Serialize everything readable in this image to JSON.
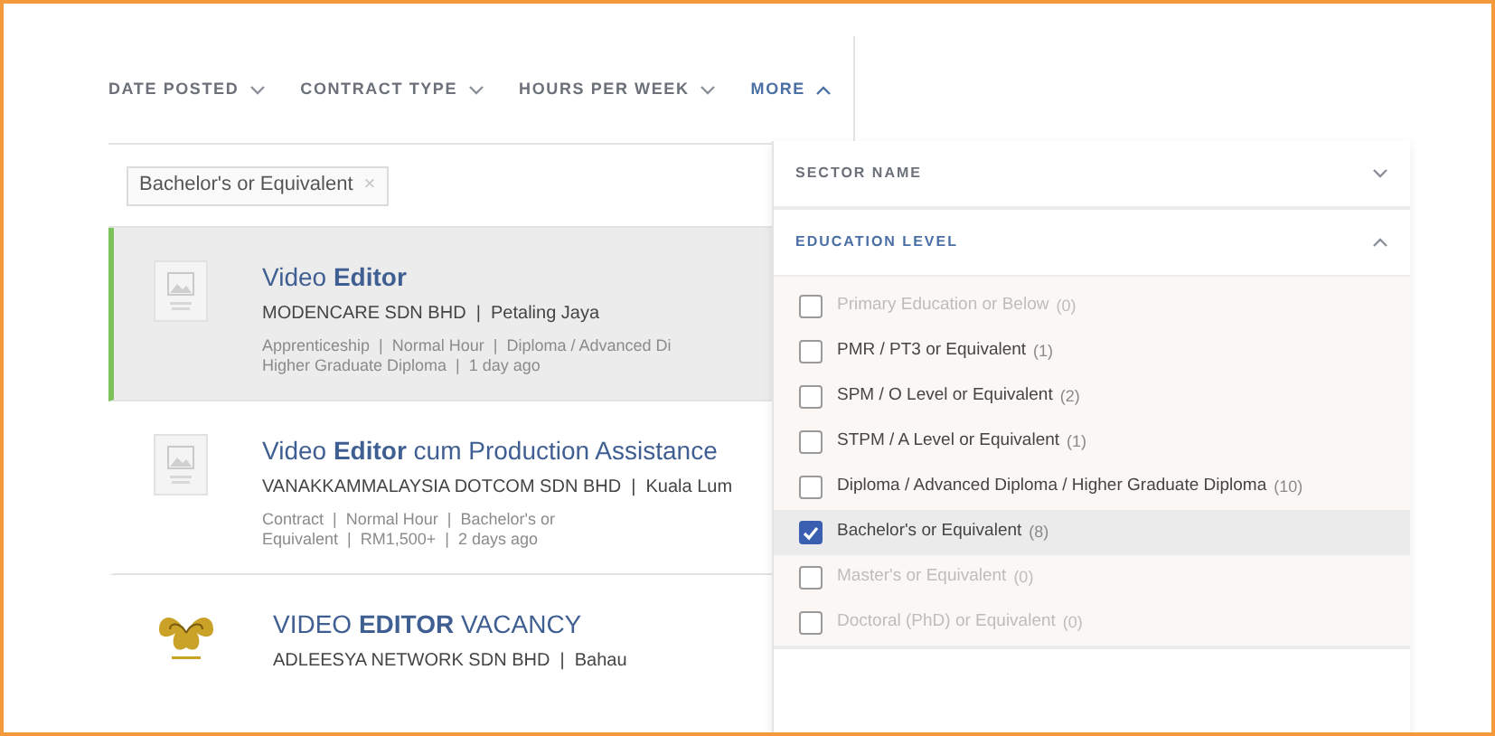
{
  "filters": [
    {
      "label": "DATE POSTED",
      "open": false
    },
    {
      "label": "CONTRACT TYPE",
      "open": false
    },
    {
      "label": "HOURS PER WEEK",
      "open": false
    },
    {
      "label": "MORE",
      "open": true
    }
  ],
  "chips": [
    {
      "label": "Bachelor's or Equivalent",
      "remove": "×"
    }
  ],
  "jobs": [
    {
      "title": "Video **Editor**",
      "company": "MODENCARE SDN BHD  |  Petaling Jaya",
      "meta": [
        "Apprenticeship  |  Normal Hour  |  Diploma / Advanced Di",
        "Higher Graduate Diploma  |  1 day ago"
      ],
      "selected": true,
      "kind": "placeholder"
    },
    {
      "title": "Video **Editor** cum Production Assistance",
      "company": "VANAKKAMMALAYSIA DOTCOM SDN BHD  |  Kuala Lum",
      "meta": [
        "Contract  |  Normal Hour  |  Bachelor's or",
        "Equivalent  |  RM1,500+  |  2 days ago"
      ],
      "selected": false,
      "kind": "placeholder"
    },
    {
      "title": "VIDEO **EDITOR** VACANCY",
      "company": "ADLEESYA NETWORK SDN BHD  |  Bahau",
      "selected": false,
      "kind": "emblem"
    }
  ],
  "panel": [
    {
      "title": "SECTOR NAME",
      "expanded": false
    },
    {
      "title": "EDUCATION LEVEL",
      "expanded": true,
      "options": [
        {
          "label": "Primary Education or Below",
          "count": "(0)",
          "checked": false,
          "disabled": true,
          "selected": false
        },
        {
          "label": "PMR / PT3 or Equivalent",
          "count": "(1)",
          "checked": false,
          "disabled": false,
          "selected": false
        },
        {
          "label": "SPM / O Level or Equivalent",
          "count": "(2)",
          "checked": false,
          "disabled": false,
          "selected": false
        },
        {
          "label": "STPM / A Level or Equivalent",
          "count": "(1)",
          "checked": false,
          "disabled": false,
          "selected": false
        },
        {
          "label": "Diploma / Advanced Diploma / Higher Graduate Diploma",
          "count": "(10)",
          "checked": false,
          "disabled": false,
          "selected": false
        },
        {
          "label": "Bachelor's or Equivalent",
          "count": "(8)",
          "checked": true,
          "disabled": false,
          "selected": true
        },
        {
          "label": "Master's or Equivalent",
          "count": "(0)",
          "checked": false,
          "disabled": true,
          "selected": false
        },
        {
          "label": "Doctoral (PhD) or Equivalent",
          "count": "(0)",
          "checked": false,
          "disabled": true,
          "selected": false
        }
      ]
    }
  ]
}
